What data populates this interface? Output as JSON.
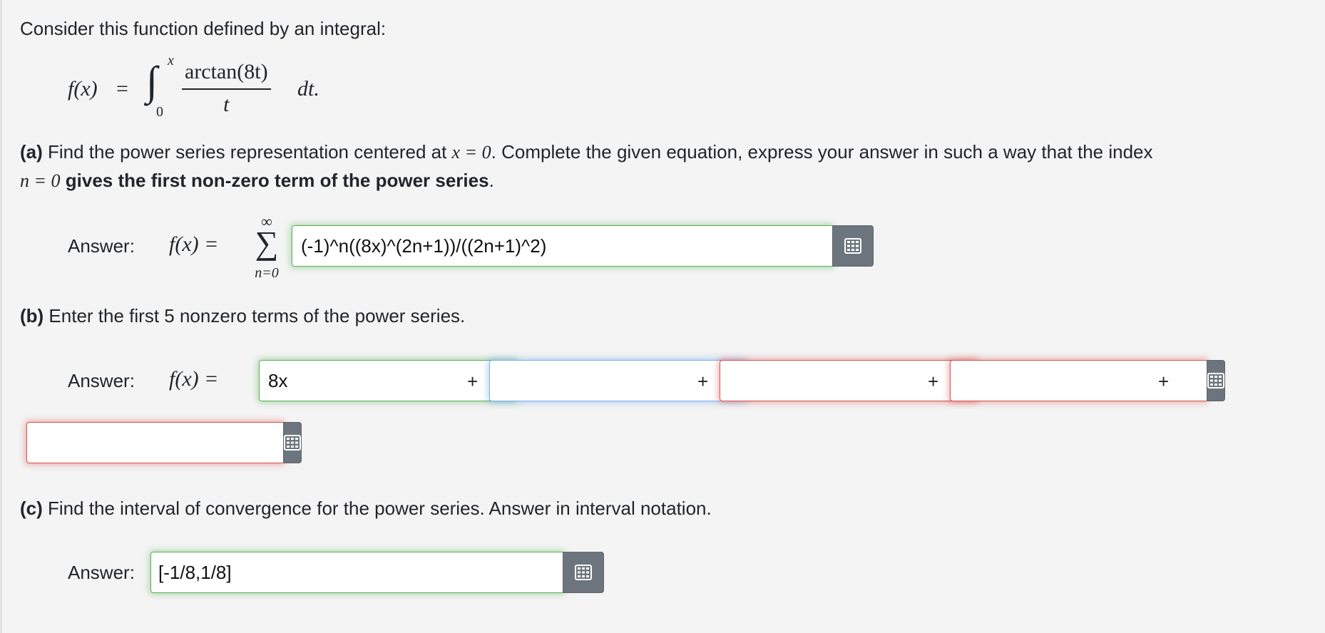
{
  "intro": "Consider this function defined by an integral:",
  "formula": {
    "lhs": "f(x)",
    "equals": "=",
    "integral": "∫",
    "upper": "x",
    "lower": "0",
    "numerator": "arctan(8t)",
    "denominator": "t",
    "dt": "dt."
  },
  "part_a": {
    "label": "(a)",
    "text1": " Find the power series representation centered at ",
    "math1": "x = 0",
    "text2": ". Complete the given equation, express your answer in such a way that the index",
    "math2": "n = 0",
    "bold_text": " gives the first non-zero term of the power series",
    "period": ".",
    "answer_label": "Answer:",
    "fx": "f(x) =",
    "sigma": "∑",
    "sigma_top": "∞",
    "sigma_bottom": "n=0",
    "value": "(-1)^n((8x)^(2n+1))/((2n+1)^2)"
  },
  "part_b": {
    "label": "(b)",
    "text": " Enter the first 5 nonzero terms of the power series.",
    "answer_label": "Answer:",
    "fx": "f(x) =",
    "plus": "+",
    "term1": "8x",
    "term2": "",
    "term3": "",
    "term4": "",
    "term5": ""
  },
  "part_c": {
    "label": "(c)",
    "text": " Find the interval of convergence for the power series. Answer in interval notation.",
    "answer_label": "Answer:",
    "value": "[-1/8,1/8]"
  },
  "icons": {
    "keypad": "keypad-grid-icon"
  },
  "colors": {
    "correct": "#58b158",
    "focused": "#7fb2f0",
    "incorrect": "#d9534f",
    "button": "#6c757d"
  }
}
